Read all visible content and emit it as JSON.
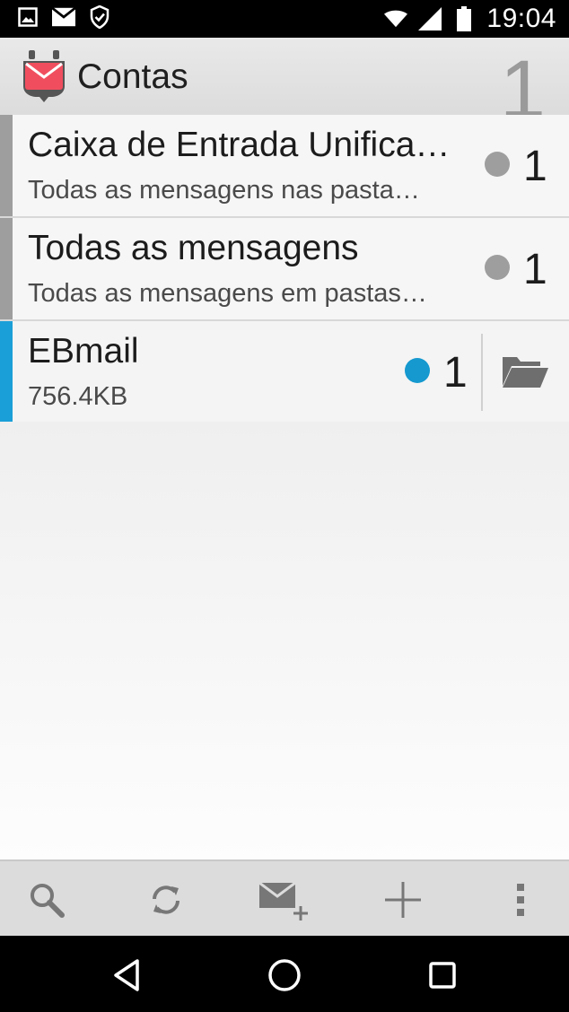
{
  "status_bar": {
    "time": "19:04",
    "icons": [
      "image-icon",
      "gmail-icon",
      "shield-check-icon",
      "wifi-icon",
      "signal-icon",
      "battery-icon"
    ]
  },
  "action_bar": {
    "title": "Contas",
    "unread_total": "1",
    "app_icon": "k9-mail-icon"
  },
  "accounts": [
    {
      "title": "Caixa de Entrada Unifica…",
      "subtitle": "Todas as mensagens nas pasta…",
      "count": "1",
      "dot_color": "#9e9e9e",
      "bar_color": "#9e9e9e"
    },
    {
      "title": "Todas as mensagens",
      "subtitle": "Todas as mensagens em pastas…",
      "count": "1",
      "dot_color": "#9e9e9e",
      "bar_color": "#9e9e9e"
    },
    {
      "title": "EBmail",
      "subtitle": "756.4KB",
      "count": "1",
      "dot_color": "#1599cf",
      "bar_color": "#1b9fd8",
      "folder_icon": "folder-open-icon"
    }
  ],
  "bottom_toolbar": {
    "buttons": [
      "search-icon",
      "refresh-icon",
      "compose-icon",
      "add-icon",
      "overflow-menu-icon"
    ]
  },
  "nav_bar": {
    "buttons": [
      "back-icon",
      "home-icon",
      "recents-icon"
    ]
  }
}
